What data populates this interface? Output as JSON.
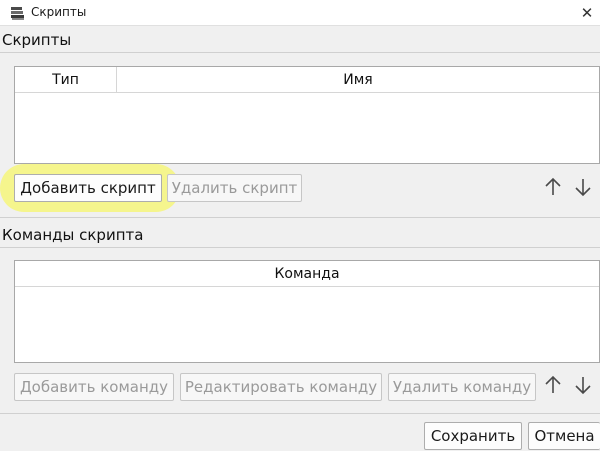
{
  "window": {
    "title": "Скрипты",
    "close_glyph": "✕"
  },
  "scripts_section": {
    "title": "Скрипты",
    "columns": [
      "Тип",
      "Имя"
    ],
    "rows": [],
    "add_label": "Добавить скрипт",
    "delete_label": "Удалить скрипт",
    "up_icon": "arrow-up-icon",
    "down_icon": "arrow-down-icon",
    "add_enabled": true,
    "delete_enabled": false
  },
  "commands_section": {
    "title": "Команды скрипта",
    "columns": [
      "Команда"
    ],
    "rows": [],
    "add_label": "Добавить команду",
    "edit_label": "Редактировать команду",
    "delete_label": "Удалить команду",
    "up_icon": "arrow-up-icon",
    "down_icon": "arrow-down-icon",
    "buttons_enabled": false
  },
  "footer": {
    "save_label": "Сохранить",
    "cancel_label": "Отмена"
  },
  "colors": {
    "highlight": "#f7f73c",
    "window_bg": "#f0f0f0",
    "table_bg": "#ffffff",
    "disabled_text": "#9a9a9a"
  }
}
